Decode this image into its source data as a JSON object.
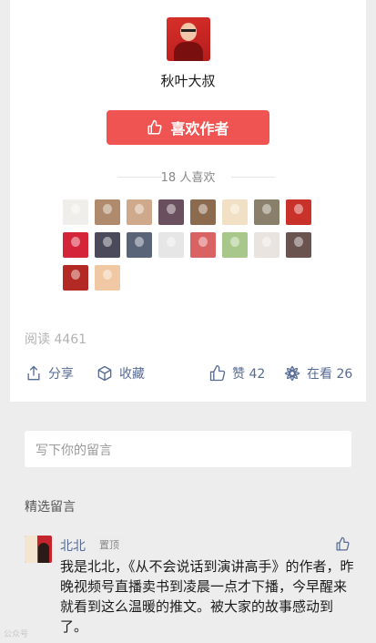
{
  "author": {
    "name": "秋叶大叔"
  },
  "like_button": {
    "label": "喜欢作者"
  },
  "likes": {
    "text": "18 人喜欢"
  },
  "liker_avatars": [
    {
      "color": "#f0eeea"
    },
    {
      "color": "#b08a6c"
    },
    {
      "color": "#cfa98c"
    },
    {
      "color": "#6a4f5e"
    },
    {
      "color": "#8c6a4e"
    },
    {
      "color": "#f2e0c4"
    },
    {
      "color": "#8a7f6a"
    },
    {
      "color": "#c9312b"
    },
    {
      "color": "#d4243a"
    },
    {
      "color": "#4a4a5a"
    },
    {
      "color": "#5a6478"
    },
    {
      "color": "#e6e6e6"
    },
    {
      "color": "#d96262"
    },
    {
      "color": "#a8c78a"
    },
    {
      "color": "#e9e4e0"
    },
    {
      "color": "#6a5450"
    },
    {
      "color": "#b32a24"
    },
    {
      "color": "#f0c8a4"
    }
  ],
  "stats": {
    "read": "阅读 4461"
  },
  "actions": {
    "share": "分享",
    "favorite": "收藏",
    "like": "赞 42",
    "watching": "在看 26"
  },
  "comment_input": {
    "placeholder": "写下你的留言"
  },
  "featured_title": "精选留言",
  "comments": [
    {
      "name": "北北",
      "badge": "置顶",
      "text": "我是北北，《从不会说话到演讲高手》的作者，昨晚视频号直播卖书到凌晨一点才下播，今早醒来就看到这么温暖的推文。被大家的故事感动到了。"
    }
  ],
  "watermark": "公众号"
}
